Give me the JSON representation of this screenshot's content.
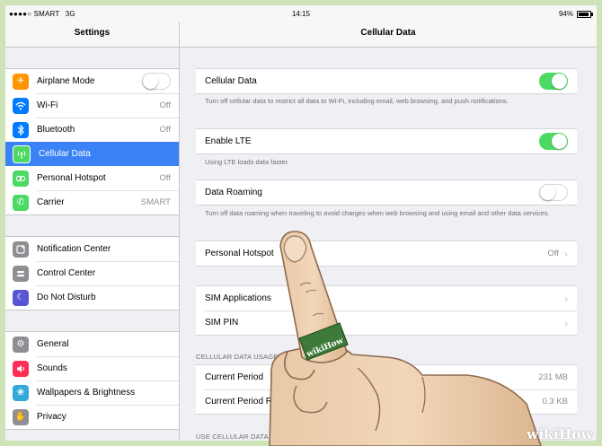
{
  "status": {
    "carrier": "SMART",
    "network": "3G",
    "time": "14:15",
    "battery": "94%"
  },
  "master": {
    "title": "Settings",
    "groups": [
      {
        "items": [
          {
            "label": "Airplane Mode",
            "icon": "airplane-icon",
            "color": "#ff9500",
            "toggle": false
          },
          {
            "label": "Wi-Fi",
            "icon": "wifi-icon",
            "color": "#007aff",
            "value": "Off"
          },
          {
            "label": "Bluetooth",
            "icon": "bluetooth-icon",
            "color": "#007aff",
            "value": "Off"
          },
          {
            "label": "Cellular Data",
            "icon": "cellular-icon",
            "color": "#4cd964",
            "selected": true
          },
          {
            "label": "Personal Hotspot",
            "icon": "hotspot-icon",
            "color": "#4cd964",
            "value": "Off"
          },
          {
            "label": "Carrier",
            "icon": "phone-icon",
            "color": "#4cd964",
            "value": "SMART"
          }
        ]
      },
      {
        "items": [
          {
            "label": "Notification Center",
            "icon": "notification-icon",
            "color": "#8e8e93"
          },
          {
            "label": "Control Center",
            "icon": "control-center-icon",
            "color": "#8e8e93"
          },
          {
            "label": "Do Not Disturb",
            "icon": "moon-icon",
            "color": "#5856d6"
          }
        ]
      },
      {
        "items": [
          {
            "label": "General",
            "icon": "gear-icon",
            "color": "#8e8e93"
          },
          {
            "label": "Sounds",
            "icon": "speaker-icon",
            "color": "#ff2d55"
          },
          {
            "label": "Wallpapers & Brightness",
            "icon": "wallpaper-icon",
            "color": "#34aadc"
          },
          {
            "label": "Privacy",
            "icon": "hand-icon",
            "color": "#8e8e93"
          }
        ]
      }
    ]
  },
  "detail": {
    "title": "Cellular Data",
    "cellular_data": {
      "label": "Cellular Data",
      "on": true,
      "footer": "Turn off cellular data to restrict all data to Wi-Fi, including email, web browsing, and push notifications."
    },
    "enable_lte": {
      "label": "Enable LTE",
      "on": true,
      "footer": "Using LTE loads data faster."
    },
    "data_roaming": {
      "label": "Data Roaming",
      "on": false,
      "footer": "Turn off data roaming when traveling to avoid charges when web browsing and using email and other data services."
    },
    "personal_hotspot": {
      "label": "Personal Hotspot",
      "value": "Off"
    },
    "sim_applications": {
      "label": "SIM Applications"
    },
    "sim_pin": {
      "label": "SIM PIN"
    },
    "usage_header": "CELLULAR DATA USAGE",
    "current_period": {
      "label": "Current Period",
      "value": "231 MB"
    },
    "current_period_roaming": {
      "label": "Current Period Roaming",
      "value": "0.3 KB"
    },
    "use_cellular_header": "USE CELLULAR DATA FOR:"
  },
  "watermark": {
    "wiki": "wiki",
    "how": "How",
    "band": "wikiHow"
  },
  "colors": {
    "accent": "#3b82f6",
    "switch_on": "#4cd964",
    "background": "#efeff4"
  }
}
